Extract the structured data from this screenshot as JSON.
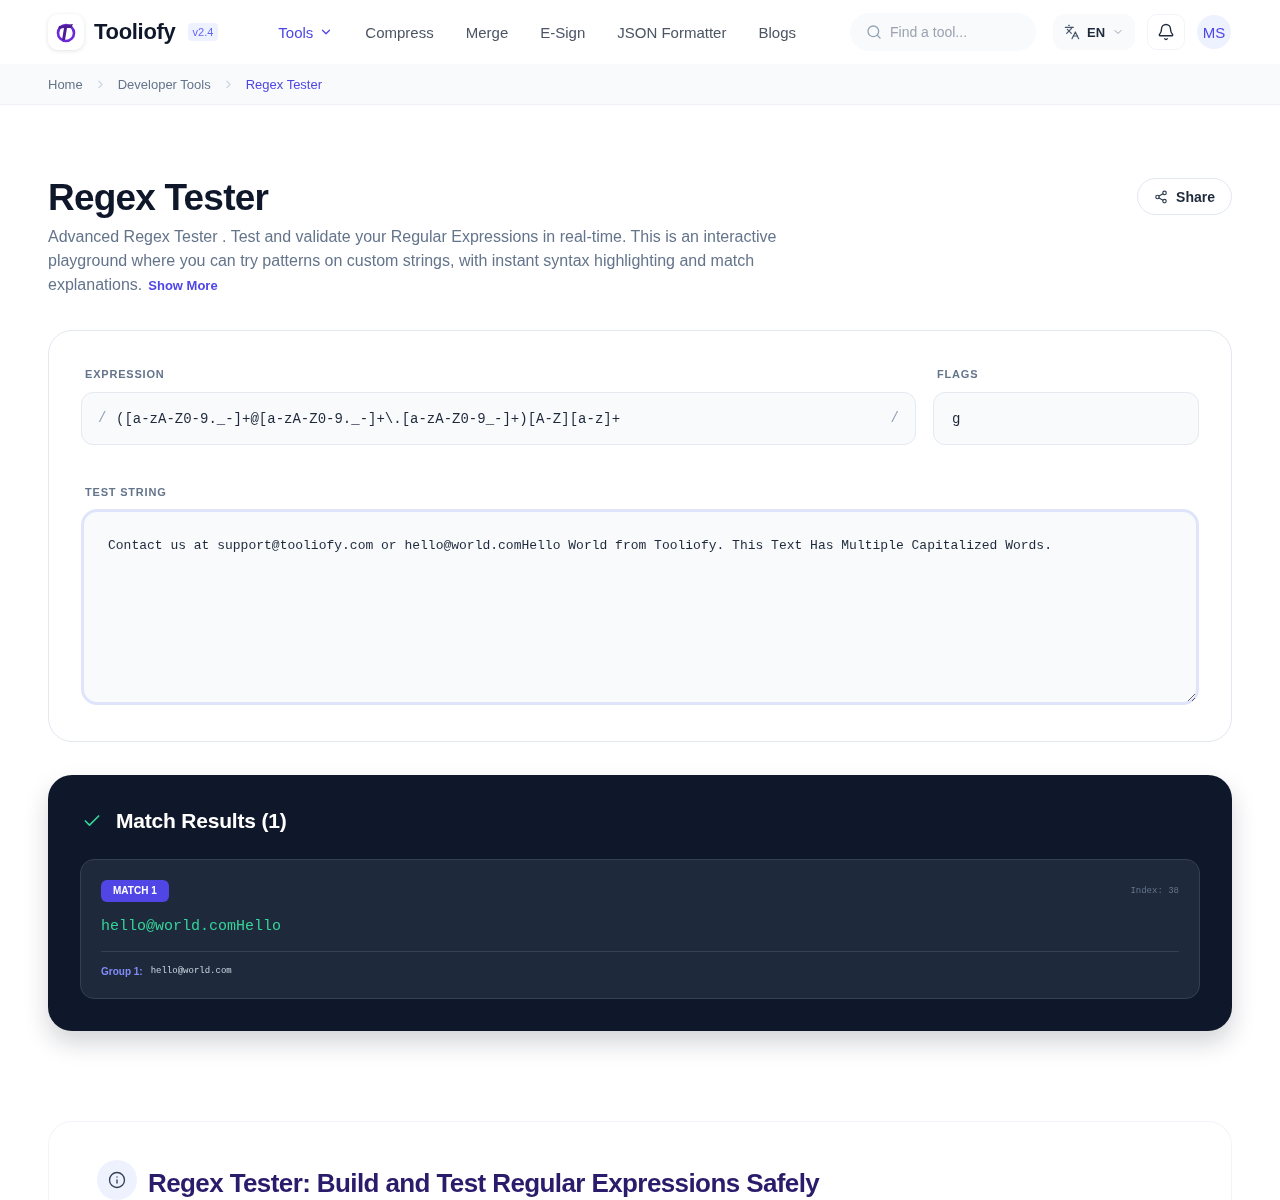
{
  "header": {
    "brand": "Tooliofy",
    "version": "v2.4",
    "nav": [
      {
        "label": "Tools",
        "kind": "dropdown",
        "selected": true
      },
      {
        "label": "Compress",
        "kind": "link",
        "selected": false
      },
      {
        "label": "Merge",
        "kind": "link",
        "selected": false
      },
      {
        "label": "E-Sign",
        "kind": "link",
        "selected": false
      },
      {
        "label": "JSON Formatter",
        "kind": "link",
        "selected": false
      },
      {
        "label": "Blogs",
        "kind": "link",
        "selected": false
      }
    ],
    "search": {
      "placeholder": "Find a tool..."
    },
    "language": "EN",
    "avatar": "MS"
  },
  "breadcrumb": [
    {
      "label": "Home",
      "current": false
    },
    {
      "label": "Developer Tools",
      "current": false
    },
    {
      "label": "Regex Tester",
      "current": true
    }
  ],
  "page": {
    "title": "Regex Tester",
    "description": "Advanced Regex Tester . Test and validate your Regular Expressions in real-time. This is an interactive playground where you can try patterns on custom strings, with instant syntax highlighting and match explanations.",
    "show_more": "Show More",
    "share": "Share"
  },
  "editor": {
    "expression": {
      "label": "EXPRESSION",
      "delimiter_open": "/",
      "value": "([a-zA-Z0-9._-]+@[a-zA-Z0-9._-]+\\.[a-zA-Z0-9_-]+)[A-Z][a-z]+",
      "delimiter_close": "/"
    },
    "flags": {
      "label": "FLAGS",
      "value": "g"
    },
    "test_string": {
      "label": "TEST STRING",
      "value": "Contact us at support@tooliofy.com or hello@world.comHello World from Tooliofy. This Text Has Multiple Capitalized Words."
    }
  },
  "results": {
    "title": "Match Results (1)",
    "matches": [
      {
        "badge": "MATCH 1",
        "index": "Index: 38",
        "value": "hello@world.comHello",
        "groups": [
          {
            "label": "Group 1:",
            "value": "hello@world.com"
          }
        ]
      }
    ]
  },
  "info": {
    "heading": "Regex Tester: Build and Test Regular Expressions Safely"
  }
}
